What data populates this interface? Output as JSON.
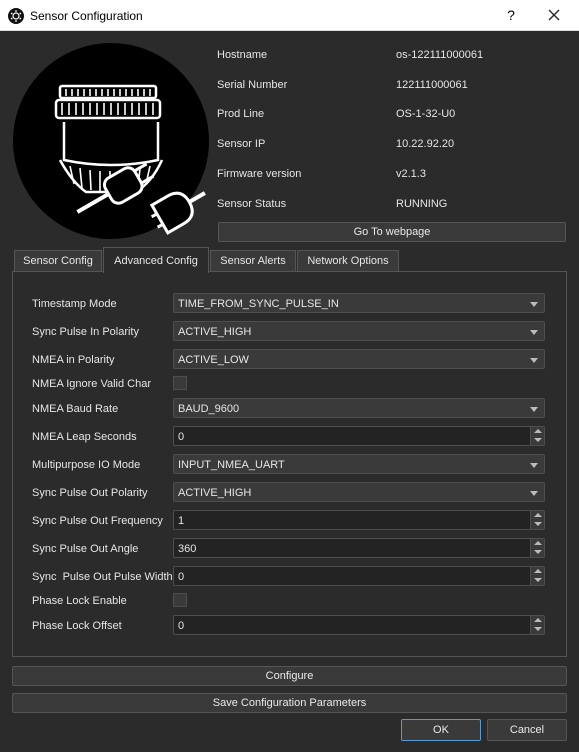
{
  "window": {
    "title": "Sensor Configuration",
    "help_glyph": "?",
    "icons": {
      "app": "ouster-app-icon",
      "help": "help-icon",
      "close": "close-icon"
    }
  },
  "sensor_info": [
    {
      "label": "Hostname",
      "value": "os-122111000061"
    },
    {
      "label": "Serial Number",
      "value": "122111000061"
    },
    {
      "label": "Prod Line",
      "value": "OS-1-32-U0"
    },
    {
      "label": "Sensor IP",
      "value": "10.22.92.20"
    },
    {
      "label": "Firmware version",
      "value": "v2.1.3"
    },
    {
      "label": "Sensor Status",
      "value": "RUNNING"
    }
  ],
  "goto_webpage_label": "Go To webpage",
  "tabs": [
    {
      "label": "Sensor Config",
      "active": false
    },
    {
      "label": "Advanced Config",
      "active": true
    },
    {
      "label": "Sensor Alerts",
      "active": false
    },
    {
      "label": "Network Options",
      "active": false
    }
  ],
  "advanced": {
    "timestamp_mode": {
      "label": "Timestamp Mode",
      "value": "TIME_FROM_SYNC_PULSE_IN"
    },
    "sync_pulse_in_polarity": {
      "label": "Sync Pulse In Polarity",
      "value": "ACTIVE_HIGH"
    },
    "nmea_in_polarity": {
      "label": "NMEA in Polarity",
      "value": "ACTIVE_LOW"
    },
    "nmea_ignore_valid_char": {
      "label": "NMEA Ignore Valid Char",
      "checked": false
    },
    "nmea_baud_rate": {
      "label": "NMEA Baud Rate",
      "value": "BAUD_9600"
    },
    "nmea_leap_seconds": {
      "label": "NMEA Leap Seconds",
      "value": "0"
    },
    "multipurpose_io_mode": {
      "label": "Multipurpose IO Mode",
      "value": "INPUT_NMEA_UART"
    },
    "sync_pulse_out_polarity": {
      "label": "Sync Pulse Out Polarity",
      "value": "ACTIVE_HIGH"
    },
    "sync_pulse_out_frequency": {
      "label": "Sync Pulse Out Frequency",
      "value": "1"
    },
    "sync_pulse_out_angle": {
      "label": "Sync Pulse Out Angle",
      "value": "360"
    },
    "sync_pulse_out_pulse_width": {
      "label": "Sync  Pulse Out Pulse Width",
      "value": "0"
    },
    "phase_lock_enable": {
      "label": "Phase Lock Enable",
      "checked": false
    },
    "phase_lock_offset": {
      "label": "Phase Lock Offset",
      "value": "0"
    }
  },
  "buttons": {
    "configure": "Configure",
    "save": "Save Configuration Parameters",
    "ok": "OK",
    "cancel": "Cancel"
  },
  "colors": {
    "background": "#2b2b2b",
    "accent_ok_border": "#5b9bd5"
  }
}
